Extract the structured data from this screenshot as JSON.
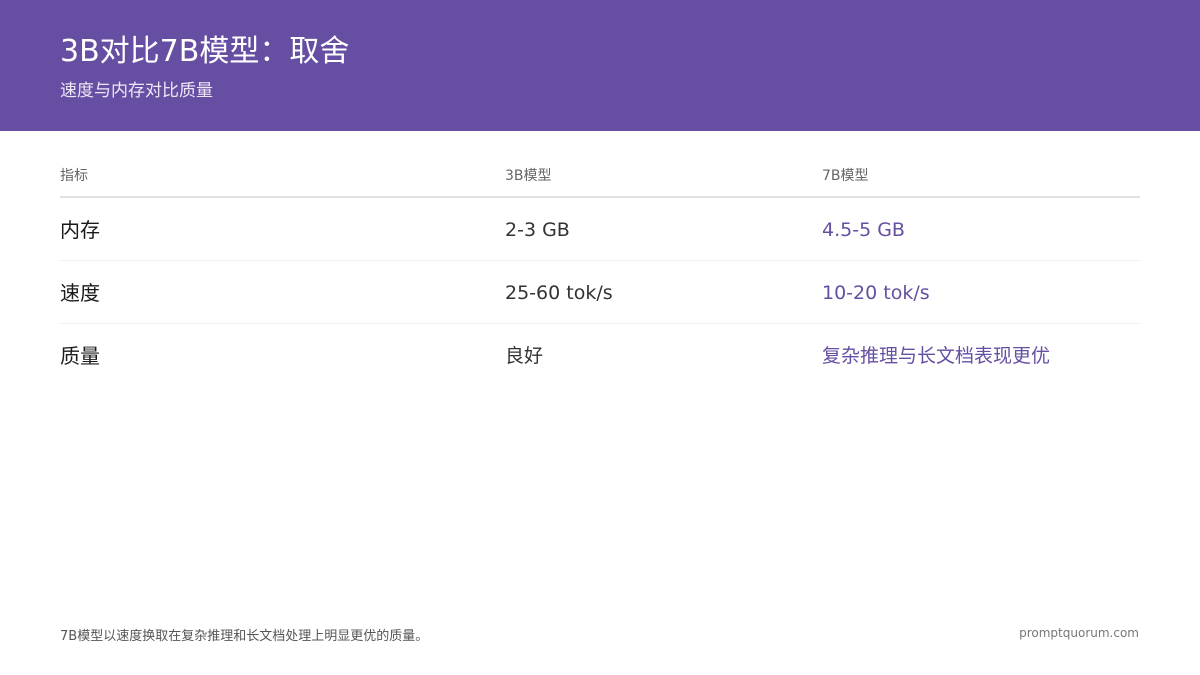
{
  "header": {
    "title": "3B对比7B模型：取舍",
    "subtitle": "速度与内存对比质量"
  },
  "table": {
    "columns": [
      "指标",
      "3B模型",
      "7B模型"
    ],
    "rows": [
      [
        "内存",
        "2-3 GB",
        "4.5-5 GB"
      ],
      [
        "速度",
        "25-60 tok/s",
        "10-20 tok/s"
      ],
      [
        "质量",
        "良好",
        "复杂推理与长文档表现更优"
      ]
    ]
  },
  "footer": {
    "note": "7B模型以速度换取在复杂推理和长文档处理上明显更优的质量。",
    "brand": "promptquorum.com"
  },
  "colors": {
    "header_bg": "#664fa3",
    "accent": "#664fa3"
  }
}
